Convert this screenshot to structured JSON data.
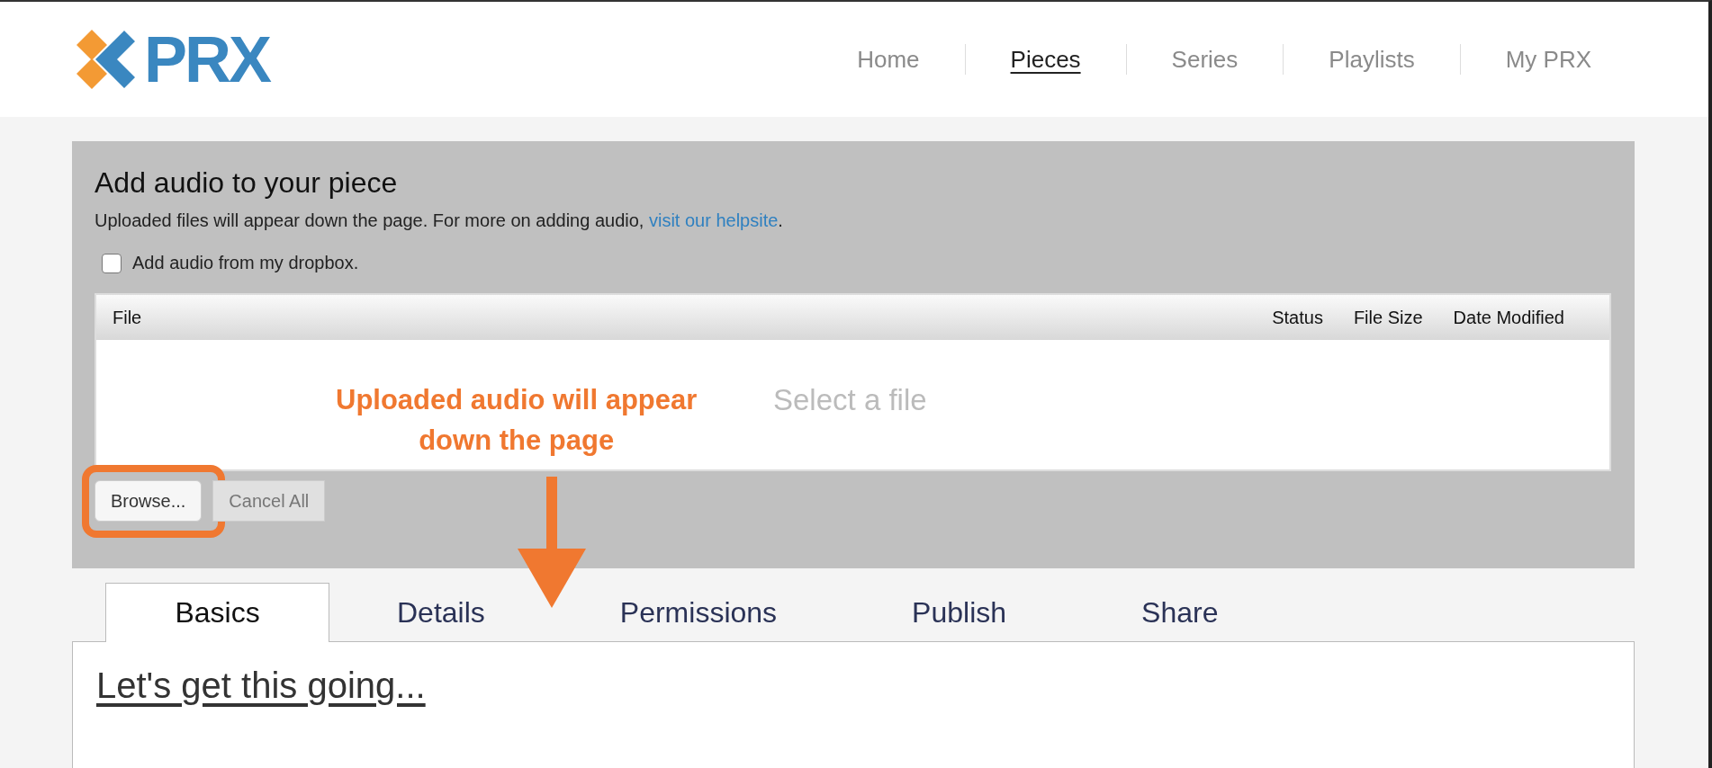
{
  "logo": {
    "text": "PRX"
  },
  "nav": [
    {
      "label": "Home",
      "selected": false
    },
    {
      "label": "Pieces",
      "selected": true
    },
    {
      "label": "Series",
      "selected": false
    },
    {
      "label": "Playlists",
      "selected": false
    },
    {
      "label": "My PRX",
      "selected": false
    }
  ],
  "upload_panel": {
    "title": "Add audio to your piece",
    "description": "Uploaded files will appear down the page. For more on adding audio,",
    "help_link": "visit our helpsite",
    "description_end": ".",
    "dropbox_checkbox": {
      "label": "Add audio from my dropbox.",
      "checked": false
    },
    "table": {
      "columns": [
        "File",
        "Status",
        "File Size",
        "Date Modified"
      ],
      "empty_text": "Select a file"
    },
    "buttons": [
      {
        "label": "Browse...",
        "highlighted": true
      },
      {
        "label": "Cancel All",
        "highlighted": false
      }
    ]
  },
  "annotation": {
    "lines": [
      "Uploaded audio will appear",
      "down the page"
    ]
  },
  "tabs": [
    {
      "label": "Basics",
      "selected": true
    },
    {
      "label": "Details",
      "selected": false
    },
    {
      "label": "Permissions",
      "selected": false
    },
    {
      "label": "Publish",
      "selected": false
    },
    {
      "label": "Share",
      "selected": false
    }
  ],
  "content": {
    "heading": "Let's get this going..."
  }
}
